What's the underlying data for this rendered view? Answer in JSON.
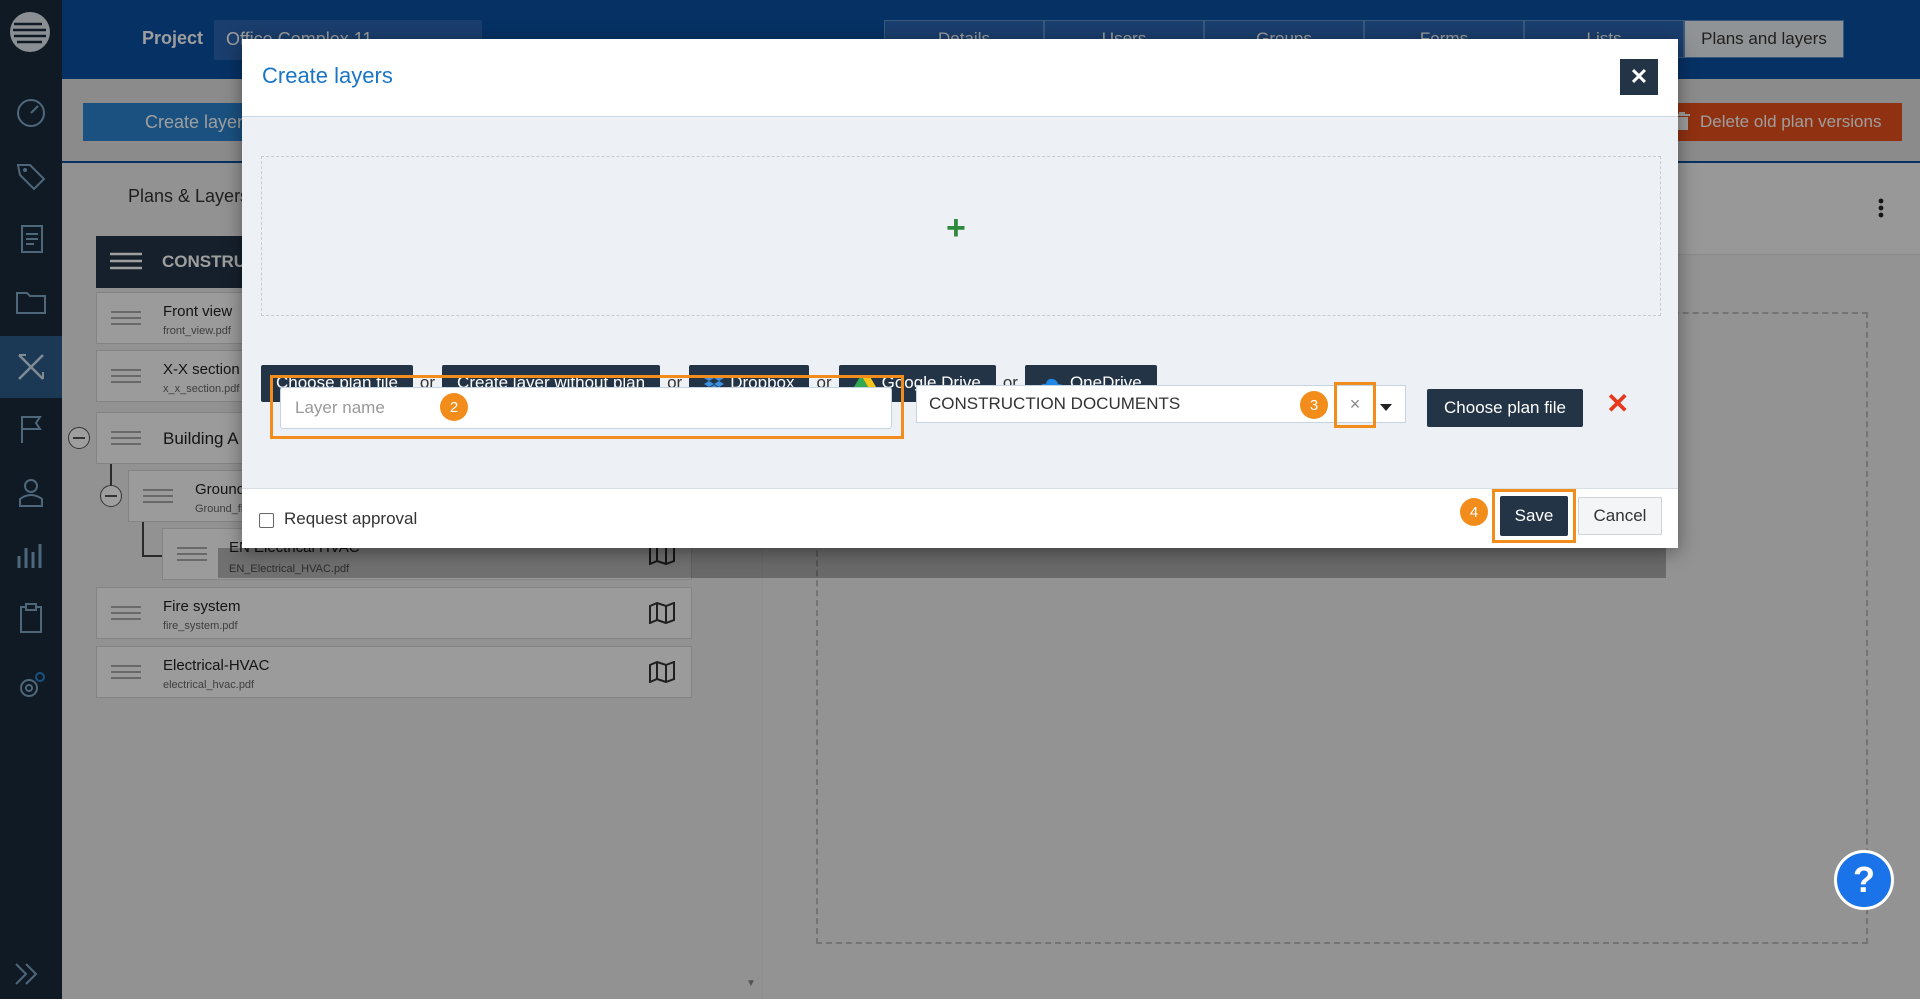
{
  "topbar": {
    "project_label": "Project",
    "project_value": "Office Complex 11",
    "tabs": [
      "Details",
      "Users",
      "Groups",
      "Forms",
      "Lists",
      "Plans and layers"
    ],
    "active_tab": "Plans and layers"
  },
  "actions": {
    "create_layers": "Create layers",
    "delete_old": "Delete old plan versions"
  },
  "left_panel": {
    "title": "Plans & Layers",
    "root": "CONSTRUCTION DOCUMENTS",
    "items": [
      {
        "title": "Front view",
        "file": "front_view.pdf"
      },
      {
        "title": "X-X section",
        "file": "x_x_section.pdf"
      },
      {
        "title": "Building A",
        "file": ""
      },
      {
        "title": "Ground floor",
        "file": "Ground_floor.pdf"
      },
      {
        "title": "EN Electrical HVAC",
        "file": "EN_Electrical_HVAC.pdf"
      },
      {
        "title": "Fire system",
        "file": "fire_system.pdf"
      },
      {
        "title": "Electrical-HVAC",
        "file": "electrical_hvac.pdf"
      }
    ]
  },
  "modal": {
    "title": "Create layers",
    "close_label": "✕",
    "plus_label": "+",
    "choose_plan": "Choose plan file",
    "or": "or",
    "without_plan": "Create layer without plan",
    "dropbox": "Dropbox",
    "google_drive": "Google Drive",
    "onedrive": "OneDrive",
    "layer_placeholder": "Layer name",
    "folder_value": "CONSTRUCTION DOCUMENTS",
    "clear_label": "×",
    "choose_plan_2": "Choose plan file",
    "remove_label": "✕",
    "request_approval": "Request approval",
    "save": "Save",
    "cancel": "Cancel",
    "badges": [
      "2",
      "3",
      "4"
    ]
  },
  "help": "?",
  "colors": {
    "brand": "#0b4fa2",
    "sidebar": "#1b2a3a",
    "dark_button": "#243447",
    "highlight": "#f28c1a",
    "danger": "#e8501c"
  }
}
